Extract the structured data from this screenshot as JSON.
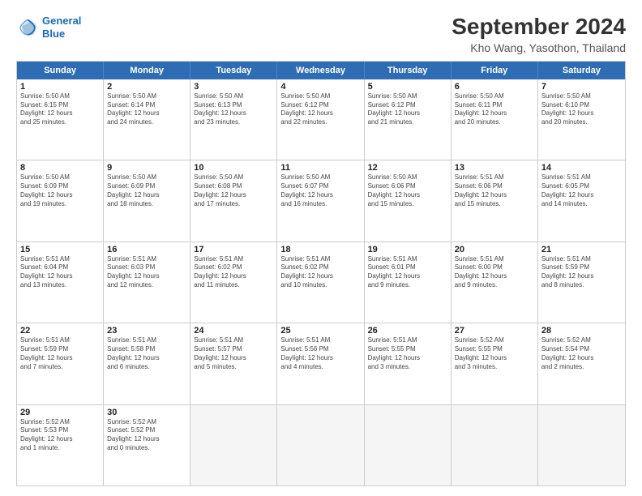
{
  "logo": {
    "line1": "General",
    "line2": "Blue"
  },
  "title": "September 2024",
  "subtitle": "Kho Wang, Yasothon, Thailand",
  "header_days": [
    "Sunday",
    "Monday",
    "Tuesday",
    "Wednesday",
    "Thursday",
    "Friday",
    "Saturday"
  ],
  "weeks": [
    [
      {
        "day": "1",
        "lines": [
          "Sunrise: 5:50 AM",
          "Sunset: 6:15 PM",
          "Daylight: 12 hours",
          "and 25 minutes."
        ]
      },
      {
        "day": "2",
        "lines": [
          "Sunrise: 5:50 AM",
          "Sunset: 6:14 PM",
          "Daylight: 12 hours",
          "and 24 minutes."
        ]
      },
      {
        "day": "3",
        "lines": [
          "Sunrise: 5:50 AM",
          "Sunset: 6:13 PM",
          "Daylight: 12 hours",
          "and 23 minutes."
        ]
      },
      {
        "day": "4",
        "lines": [
          "Sunrise: 5:50 AM",
          "Sunset: 6:12 PM",
          "Daylight: 12 hours",
          "and 22 minutes."
        ]
      },
      {
        "day": "5",
        "lines": [
          "Sunrise: 5:50 AM",
          "Sunset: 6:12 PM",
          "Daylight: 12 hours",
          "and 21 minutes."
        ]
      },
      {
        "day": "6",
        "lines": [
          "Sunrise: 5:50 AM",
          "Sunset: 6:11 PM",
          "Daylight: 12 hours",
          "and 20 minutes."
        ]
      },
      {
        "day": "7",
        "lines": [
          "Sunrise: 5:50 AM",
          "Sunset: 6:10 PM",
          "Daylight: 12 hours",
          "and 20 minutes."
        ]
      }
    ],
    [
      {
        "day": "8",
        "lines": [
          "Sunrise: 5:50 AM",
          "Sunset: 6:09 PM",
          "Daylight: 12 hours",
          "and 19 minutes."
        ]
      },
      {
        "day": "9",
        "lines": [
          "Sunrise: 5:50 AM",
          "Sunset: 6:09 PM",
          "Daylight: 12 hours",
          "and 18 minutes."
        ]
      },
      {
        "day": "10",
        "lines": [
          "Sunrise: 5:50 AM",
          "Sunset: 6:08 PM",
          "Daylight: 12 hours",
          "and 17 minutes."
        ]
      },
      {
        "day": "11",
        "lines": [
          "Sunrise: 5:50 AM",
          "Sunset: 6:07 PM",
          "Daylight: 12 hours",
          "and 16 minutes."
        ]
      },
      {
        "day": "12",
        "lines": [
          "Sunrise: 5:50 AM",
          "Sunset: 6:06 PM",
          "Daylight: 12 hours",
          "and 15 minutes."
        ]
      },
      {
        "day": "13",
        "lines": [
          "Sunrise: 5:51 AM",
          "Sunset: 6:06 PM",
          "Daylight: 12 hours",
          "and 15 minutes."
        ]
      },
      {
        "day": "14",
        "lines": [
          "Sunrise: 5:51 AM",
          "Sunset: 6:05 PM",
          "Daylight: 12 hours",
          "and 14 minutes."
        ]
      }
    ],
    [
      {
        "day": "15",
        "lines": [
          "Sunrise: 5:51 AM",
          "Sunset: 6:04 PM",
          "Daylight: 12 hours",
          "and 13 minutes."
        ]
      },
      {
        "day": "16",
        "lines": [
          "Sunrise: 5:51 AM",
          "Sunset: 6:03 PM",
          "Daylight: 12 hours",
          "and 12 minutes."
        ]
      },
      {
        "day": "17",
        "lines": [
          "Sunrise: 5:51 AM",
          "Sunset: 6:02 PM",
          "Daylight: 12 hours",
          "and 11 minutes."
        ]
      },
      {
        "day": "18",
        "lines": [
          "Sunrise: 5:51 AM",
          "Sunset: 6:02 PM",
          "Daylight: 12 hours",
          "and 10 minutes."
        ]
      },
      {
        "day": "19",
        "lines": [
          "Sunrise: 5:51 AM",
          "Sunset: 6:01 PM",
          "Daylight: 12 hours",
          "and 9 minutes."
        ]
      },
      {
        "day": "20",
        "lines": [
          "Sunrise: 5:51 AM",
          "Sunset: 6:00 PM",
          "Daylight: 12 hours",
          "and 9 minutes."
        ]
      },
      {
        "day": "21",
        "lines": [
          "Sunrise: 5:51 AM",
          "Sunset: 5:59 PM",
          "Daylight: 12 hours",
          "and 8 minutes."
        ]
      }
    ],
    [
      {
        "day": "22",
        "lines": [
          "Sunrise: 5:51 AM",
          "Sunset: 5:59 PM",
          "Daylight: 12 hours",
          "and 7 minutes."
        ]
      },
      {
        "day": "23",
        "lines": [
          "Sunrise: 5:51 AM",
          "Sunset: 5:58 PM",
          "Daylight: 12 hours",
          "and 6 minutes."
        ]
      },
      {
        "day": "24",
        "lines": [
          "Sunrise: 5:51 AM",
          "Sunset: 5:57 PM",
          "Daylight: 12 hours",
          "and 5 minutes."
        ]
      },
      {
        "day": "25",
        "lines": [
          "Sunrise: 5:51 AM",
          "Sunset: 5:56 PM",
          "Daylight: 12 hours",
          "and 4 minutes."
        ]
      },
      {
        "day": "26",
        "lines": [
          "Sunrise: 5:51 AM",
          "Sunset: 5:55 PM",
          "Daylight: 12 hours",
          "and 3 minutes."
        ]
      },
      {
        "day": "27",
        "lines": [
          "Sunrise: 5:52 AM",
          "Sunset: 5:55 PM",
          "Daylight: 12 hours",
          "and 3 minutes."
        ]
      },
      {
        "day": "28",
        "lines": [
          "Sunrise: 5:52 AM",
          "Sunset: 5:54 PM",
          "Daylight: 12 hours",
          "and 2 minutes."
        ]
      }
    ],
    [
      {
        "day": "29",
        "lines": [
          "Sunrise: 5:52 AM",
          "Sunset: 5:53 PM",
          "Daylight: 12 hours",
          "and 1 minute."
        ]
      },
      {
        "day": "30",
        "lines": [
          "Sunrise: 5:52 AM",
          "Sunset: 5:52 PM",
          "Daylight: 12 hours",
          "and 0 minutes."
        ]
      },
      {
        "day": "",
        "lines": []
      },
      {
        "day": "",
        "lines": []
      },
      {
        "day": "",
        "lines": []
      },
      {
        "day": "",
        "lines": []
      },
      {
        "day": "",
        "lines": []
      }
    ]
  ]
}
